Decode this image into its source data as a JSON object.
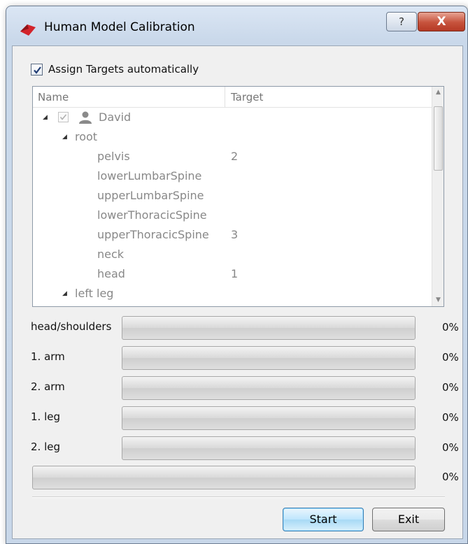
{
  "window": {
    "title": "Human Model Calibration",
    "help_label": "?",
    "close_label": "X"
  },
  "assign": {
    "label": "Assign Targets automatically",
    "checked": true
  },
  "tree": {
    "columns": [
      "Name",
      "Target"
    ],
    "nodes": [
      {
        "label": "David",
        "target": "",
        "level": 0,
        "expanded": true,
        "checkbox": true,
        "icon": "person-icon"
      },
      {
        "label": "root",
        "target": "",
        "level": 1,
        "expanded": true
      },
      {
        "label": "pelvis",
        "target": "2",
        "level": 2
      },
      {
        "label": "lowerLumbarSpine",
        "target": "",
        "level": 2
      },
      {
        "label": "upperLumbarSpine",
        "target": "",
        "level": 2
      },
      {
        "label": "lowerThoracicSpine",
        "target": "",
        "level": 2
      },
      {
        "label": "upperThoracicSpine",
        "target": "3",
        "level": 2
      },
      {
        "label": "neck",
        "target": "",
        "level": 2
      },
      {
        "label": "head",
        "target": "1",
        "level": 2
      },
      {
        "label": "left leg",
        "target": "",
        "level": 1,
        "expanded": true
      }
    ]
  },
  "progress": [
    {
      "label": "head/shoulders",
      "value": 0,
      "percent_text": "0%"
    },
    {
      "label": "1. arm",
      "value": 0,
      "percent_text": "0%"
    },
    {
      "label": "2. arm",
      "value": 0,
      "percent_text": "0%"
    },
    {
      "label": "1. leg",
      "value": 0,
      "percent_text": "0%"
    },
    {
      "label": "2. leg",
      "value": 0,
      "percent_text": "0%"
    },
    {
      "label": "",
      "value": 0,
      "percent_text": "0%"
    }
  ],
  "buttons": {
    "start_label": "Start",
    "exit_label": "Exit"
  },
  "colors": {
    "accent": "#3c7fb1",
    "progress_fill": "#3fb34f",
    "close_button": "#c6523c"
  }
}
